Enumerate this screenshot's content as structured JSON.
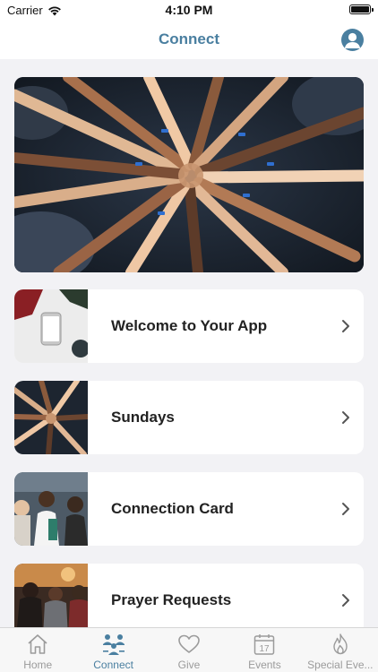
{
  "status_bar": {
    "carrier": "Carrier",
    "time": "4:10 PM"
  },
  "nav": {
    "title": "Connect",
    "profile_icon": "person-circle-icon"
  },
  "hero": {
    "image": "hands-joined-in-circle-photo"
  },
  "cards": [
    {
      "label": "Welcome to Your App",
      "image": "phone-on-desk-photo"
    },
    {
      "label": "Sundays",
      "image": "hands-joined-photo"
    },
    {
      "label": "Connection Card",
      "image": "people-talking-photo"
    },
    {
      "label": "Prayer Requests",
      "image": "group-praying-photo"
    }
  ],
  "tab_bar": {
    "items": [
      {
        "label": "Home",
        "icon": "house-icon",
        "active": false
      },
      {
        "label": "Connect",
        "icon": "people-connect-icon",
        "active": true
      },
      {
        "label": "Give",
        "icon": "heart-icon",
        "active": false
      },
      {
        "label": "Events",
        "icon": "calendar-icon",
        "active": false,
        "calendar_day": "17"
      },
      {
        "label": "Special Eve...",
        "icon": "flame-icon",
        "active": false
      }
    ]
  },
  "colors": {
    "accent": "#4a7fa0",
    "inactive": "#9b9b9b",
    "background": "#f2f2f5",
    "card": "#ffffff"
  }
}
